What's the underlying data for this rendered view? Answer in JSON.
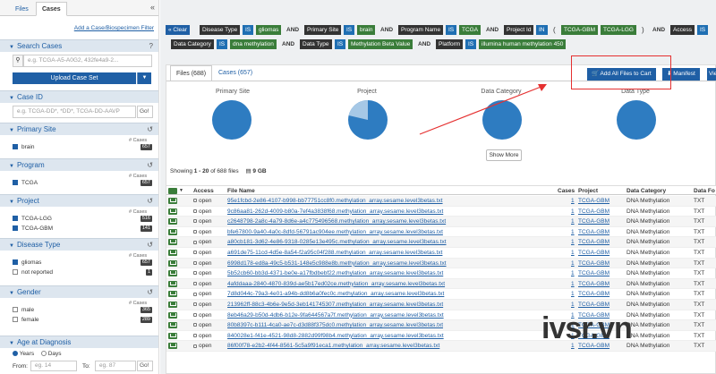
{
  "sidebar": {
    "tabs": [
      "Files",
      "Cases"
    ],
    "collapse": "«",
    "add_filter": "Add a Case/Biospecimen Filter",
    "search_cases": {
      "title": "Search Cases",
      "placeholder": "e.g. TCGA-A5-A0G2, 432fe4a9-2...",
      "upload_btn": "Upload Case Set"
    },
    "case_id": {
      "title": "Case ID",
      "placeholder": "e.g. TCGA-DD*, *DD*, TCGA-DD-AAVP",
      "go": "Go!"
    },
    "facets": [
      {
        "title": "Primary Site",
        "count_label": "# Cases",
        "items": [
          {
            "label": "brain",
            "count": "657",
            "checked": true
          }
        ]
      },
      {
        "title": "Program",
        "count_label": "# Cases",
        "items": [
          {
            "label": "TCGA",
            "count": "657",
            "checked": true
          }
        ]
      },
      {
        "title": "Project",
        "count_label": "# Cases",
        "items": [
          {
            "label": "TCGA-LGG",
            "count": "516",
            "checked": true
          },
          {
            "label": "TCGA-GBM",
            "count": "141",
            "checked": true
          }
        ]
      },
      {
        "title": "Disease Type",
        "count_label": "# Cases",
        "items": [
          {
            "label": "gliomas",
            "count": "657",
            "checked": true
          },
          {
            "label": "not reported",
            "count": "1",
            "checked": false
          }
        ]
      },
      {
        "title": "Gender",
        "count_label": "# Cases",
        "items": [
          {
            "label": "male",
            "count": "365",
            "checked": false
          },
          {
            "label": "female",
            "count": "289",
            "checked": false
          }
        ]
      }
    ],
    "age": {
      "title": "Age at Diagnosis",
      "years": "Years",
      "days": "Days",
      "from_label": "From:",
      "from_placeholder": "eg. 14",
      "to_label": "To:",
      "to_placeholder": "eg. 87",
      "go": "Go!"
    }
  },
  "query": {
    "clear": "Clear",
    "row1": [
      "Disease Type",
      "IS",
      "gliomas",
      "AND",
      "Primary Site",
      "IS",
      "brain",
      "AND",
      "Program Name",
      "IS",
      "TCGA",
      "AND",
      "Project Id",
      "IN",
      "(",
      "TCGA-GBM",
      "TCGA-LGG",
      ")",
      "AND",
      "Access",
      "IS"
    ],
    "row2": [
      "Data Category",
      "IS",
      "dna methylation",
      "AND",
      "Data Type",
      "IS",
      "Methylation Beta Value",
      "AND",
      "Platform",
      "IS",
      "illumina human methylation 450"
    ]
  },
  "panel": {
    "tabs": [
      "Files (688)",
      "Cases (657)"
    ],
    "add_all": "Add All Files to Cart",
    "manifest": "Manifest",
    "view": "Vie",
    "charts": [
      "Primary Site",
      "Project",
      "Data Category",
      "Data Type"
    ],
    "show_more": "Show More",
    "showing_prefix": "Showing",
    "showing_range": "1 - 20",
    "showing_suffix": "of 688 files",
    "size": "9 GB",
    "columns": [
      "Access",
      "File Name",
      "Cases",
      "Project",
      "Data Category",
      "Data Fo"
    ],
    "rows": [
      {
        "access": "open",
        "file": "95e1fcbd-2e86-4107-b998-bb77751cc8f0.methylation_array.sesame.level3betas.txt",
        "cases": "1",
        "project": "TCGA-GBM",
        "category": "DNA Methylation",
        "format": "TXT"
      },
      {
        "access": "open",
        "file": "9c86aa81-262d-4009-b80a-7ef4a3838f68.methylation_array.sesame.level3betas.txt",
        "cases": "1",
        "project": "TCGA-GBM",
        "category": "DNA Methylation",
        "format": "TXT"
      },
      {
        "access": "open",
        "file": "c2648798-2a8c-4a79-8d6e-a4c775496568.methylation_array.sesame.level3betas.txt",
        "cases": "1",
        "project": "TCGA-GBM",
        "category": "DNA Methylation",
        "format": "TXT"
      },
      {
        "access": "open",
        "file": "bfe67800-9a40-4a0c-8dfd-56791ac904ee.methylation_array.sesame.level3betas.txt",
        "cases": "1",
        "project": "TCGA-GBM",
        "category": "DNA Methylation",
        "format": "TXT"
      },
      {
        "access": "open",
        "file": "a80cb181-3d62-4e86-9318-0285e13e495c.methylation_array.sesame.level3betas.txt",
        "cases": "1",
        "project": "TCGA-GBM",
        "category": "DNA Methylation",
        "format": "TXT"
      },
      {
        "access": "open",
        "file": "a691de75-11cd-4d5e-8a54-f2a95c04f288.methylation_array.sesame.level3betas.txt",
        "cases": "1",
        "project": "TCGA-GBM",
        "category": "DNA Methylation",
        "format": "TXT"
      },
      {
        "access": "open",
        "file": "6998d178-ed8a-49c5-b531-148e5c988e8b.methylation_array.sesame.level3betas.txt",
        "cases": "1",
        "project": "TCGA-GBM",
        "category": "DNA Methylation",
        "format": "TXT"
      },
      {
        "access": "open",
        "file": "5b52cb60-bb3d-4371-be0e-a17fbdbebf22.methylation_array.sesame.level3betas.txt",
        "cases": "1",
        "project": "TCGA-GBM",
        "category": "DNA Methylation",
        "format": "TXT"
      },
      {
        "access": "open",
        "file": "4afddaaa-2840-4870-839d-ae5b17ed02ce.methylation_array.sesame.level3betas.txt",
        "cases": "1",
        "project": "TCGA-GBM",
        "category": "DNA Methylation",
        "format": "TXT"
      },
      {
        "access": "open",
        "file": "7d8d044c-79a3-4e01-a94b-dd8b6a0fec0c.methylation_array.sesame.level3betas.txt",
        "cases": "1",
        "project": "TCGA-GBM",
        "category": "DNA Methylation",
        "format": "TXT"
      },
      {
        "access": "open",
        "file": "213962ff-88c3-4b6e-9e5d-3eb141745307.methylation_array.sesame.level3betas.txt",
        "cases": "1",
        "project": "TCGA-GBM",
        "category": "DNA Methylation",
        "format": "TXT"
      },
      {
        "access": "open",
        "file": "8eb46a29-b50d-4db6-b12e-9fa644567a7f.methylation_array.sesame.level3betas.txt",
        "cases": "1",
        "project": "TCGA-GBM",
        "category": "DNA Methylation",
        "format": "TXT"
      },
      {
        "access": "open",
        "file": "80b8397c-b111-4ca0-ae7c-d3d88f375dc0.methylation_array.sesame.level3betas.txt",
        "cases": "1",
        "project": "TCGA-GBM",
        "category": "DNA Methylation",
        "format": "TXT"
      },
      {
        "access": "open",
        "file": "840028e1-f41e-4521-98d8-2882d99f98b4.methylation_array.sesame.level3betas.txt",
        "cases": "1",
        "project": "TCGA-GBM",
        "category": "DNA Methylation",
        "format": "TXT"
      },
      {
        "access": "open",
        "file": "86f00f78-e2b2-4f44-8561-5c5a9f91eca1.methylation_array.sesame.level3betas.txt",
        "cases": "1",
        "project": "TCGA-GBM",
        "category": "DNA Methylation",
        "format": "TXT"
      }
    ]
  },
  "watermark": "ivsr.vn"
}
